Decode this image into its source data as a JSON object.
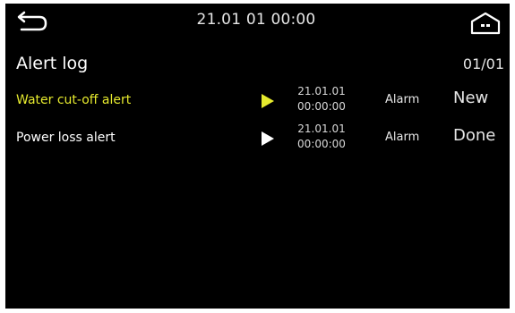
{
  "header": {
    "datetime": "21.01 01 00:00"
  },
  "page": {
    "title": "Alert log",
    "counter": "01/01"
  },
  "colors": {
    "active": "#e6ea2e",
    "normal": "#ffffff"
  },
  "alerts": [
    {
      "name": "Water cut-off alert",
      "date": "21.01.01",
      "time": "00:00:00",
      "type": "Alarm",
      "status": "New",
      "highlight": true
    },
    {
      "name": "Power loss alert",
      "date": "21.01.01",
      "time": "00:00:00",
      "type": "Alarm",
      "status": "Done",
      "highlight": false
    }
  ],
  "icons": {
    "back": "back-arrow-icon",
    "home": "home-icon",
    "play": "play-icon"
  }
}
